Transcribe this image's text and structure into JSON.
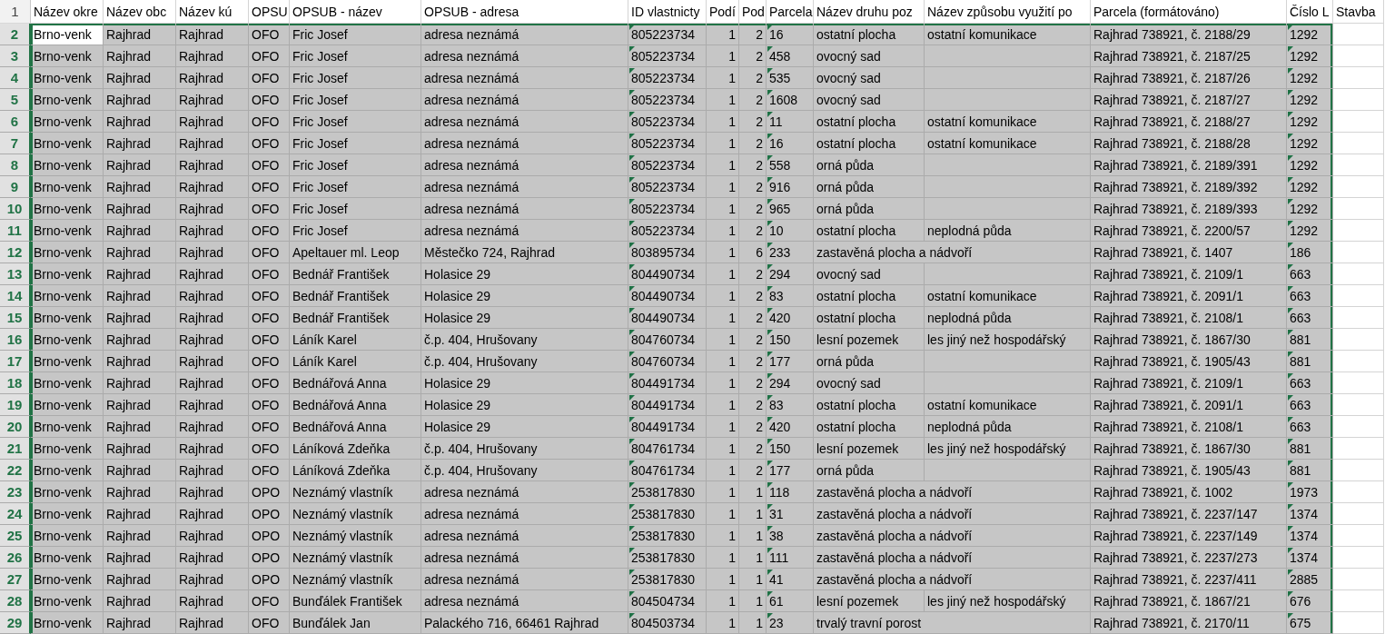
{
  "columns": [
    {
      "kind": "text",
      "selected": true,
      "flagged": false
    },
    {
      "kind": "text",
      "selected": true,
      "flagged": false
    },
    {
      "kind": "text",
      "selected": true,
      "flagged": false
    },
    {
      "kind": "text",
      "selected": true,
      "flagged": false
    },
    {
      "kind": "text",
      "selected": true,
      "flagged": false
    },
    {
      "kind": "text",
      "selected": true,
      "flagged": false
    },
    {
      "kind": "text",
      "selected": true,
      "flagged": true
    },
    {
      "kind": "number",
      "selected": true,
      "flagged": false
    },
    {
      "kind": "number",
      "selected": true,
      "flagged": false
    },
    {
      "kind": "text",
      "selected": true,
      "flagged": true
    },
    {
      "kind": "text",
      "selected": true,
      "flagged": false
    },
    {
      "kind": "text",
      "selected": true,
      "flagged": false
    },
    {
      "kind": "text",
      "selected": true,
      "flagged": false
    },
    {
      "kind": "text",
      "selected": true,
      "flagged": true
    },
    {
      "kind": "text",
      "selected": false,
      "flagged": false
    }
  ],
  "header_row": {
    "number": "1",
    "cells": [
      "Název okre",
      "Název obc",
      "Název kú",
      "OPSU",
      "OPSUB - název",
      "OPSUB  - adresa",
      "ID vlastnicty",
      "Podí",
      "Pod",
      "Parcela",
      "Název druhu poz",
      "Název způsobu využití po",
      "Parcela (formátováno)",
      "Číslo L",
      "Stavba"
    ]
  },
  "rows": [
    {
      "number": "2",
      "selected": true,
      "active": true,
      "cells": [
        "Brno-venk",
        "Rajhrad",
        "Rajhrad",
        "OFO",
        "Fric Josef",
        "adresa neznámá",
        "805223734",
        "1",
        "2",
        "16",
        "ostatní plocha",
        "ostatní komunikace",
        "Rajhrad 738921, č. 2188/29",
        "1292"
      ]
    },
    {
      "number": "3",
      "selected": true,
      "active": false,
      "cells": [
        "Brno-venk",
        "Rajhrad",
        "Rajhrad",
        "OFO",
        "Fric Josef",
        "adresa neznámá",
        "805223734",
        "1",
        "2",
        "458",
        "ovocný sad",
        null,
        "Rajhrad 738921, č. 2187/25",
        "1292"
      ]
    },
    {
      "number": "4",
      "selected": true,
      "active": false,
      "cells": [
        "Brno-venk",
        "Rajhrad",
        "Rajhrad",
        "OFO",
        "Fric Josef",
        "adresa neznámá",
        "805223734",
        "1",
        "2",
        "535",
        "ovocný sad",
        null,
        "Rajhrad 738921, č. 2187/26",
        "1292"
      ]
    },
    {
      "number": "5",
      "selected": true,
      "active": false,
      "cells": [
        "Brno-venk",
        "Rajhrad",
        "Rajhrad",
        "OFO",
        "Fric Josef",
        "adresa neznámá",
        "805223734",
        "1",
        "2",
        "1608",
        "ovocný sad",
        null,
        "Rajhrad 738921, č. 2187/27",
        "1292"
      ]
    },
    {
      "number": "6",
      "selected": true,
      "active": false,
      "cells": [
        "Brno-venk",
        "Rajhrad",
        "Rajhrad",
        "OFO",
        "Fric Josef",
        "adresa neznámá",
        "805223734",
        "1",
        "2",
        "11",
        "ostatní plocha",
        "ostatní komunikace",
        "Rajhrad 738921, č. 2188/27",
        "1292"
      ]
    },
    {
      "number": "7",
      "selected": true,
      "active": false,
      "cells": [
        "Brno-venk",
        "Rajhrad",
        "Rajhrad",
        "OFO",
        "Fric Josef",
        "adresa neznámá",
        "805223734",
        "1",
        "2",
        "16",
        "ostatní plocha",
        "ostatní komunikace",
        "Rajhrad 738921, č. 2188/28",
        "1292"
      ]
    },
    {
      "number": "8",
      "selected": true,
      "active": false,
      "cells": [
        "Brno-venk",
        "Rajhrad",
        "Rajhrad",
        "OFO",
        "Fric Josef",
        "adresa neznámá",
        "805223734",
        "1",
        "2",
        "558",
        "orná půda",
        null,
        "Rajhrad 738921, č. 2189/391",
        "1292"
      ]
    },
    {
      "number": "9",
      "selected": true,
      "active": false,
      "cells": [
        "Brno-venk",
        "Rajhrad",
        "Rajhrad",
        "OFO",
        "Fric Josef",
        "adresa neznámá",
        "805223734",
        "1",
        "2",
        "916",
        "orná půda",
        null,
        "Rajhrad 738921, č. 2189/392",
        "1292"
      ]
    },
    {
      "number": "10",
      "selected": true,
      "active": false,
      "cells": [
        "Brno-venk",
        "Rajhrad",
        "Rajhrad",
        "OFO",
        "Fric Josef",
        "adresa neznámá",
        "805223734",
        "1",
        "2",
        "965",
        "orná půda",
        null,
        "Rajhrad 738921, č. 2189/393",
        "1292"
      ]
    },
    {
      "number": "11",
      "selected": true,
      "active": false,
      "cells": [
        "Brno-venk",
        "Rajhrad",
        "Rajhrad",
        "OFO",
        "Fric Josef",
        "adresa neznámá",
        "805223734",
        "1",
        "2",
        "10",
        "ostatní plocha",
        "neplodná půda",
        "Rajhrad 738921, č. 2200/57",
        "1292"
      ]
    },
    {
      "number": "12",
      "selected": true,
      "active": false,
      "cells": [
        "Brno-venk",
        "Rajhrad",
        "Rajhrad",
        "OFO",
        "Apeltauer ml. Leop",
        "Městečko 724, Rajhrad",
        "803895734",
        "1",
        "6",
        "233",
        "zastavěná plocha a nádvoří",
        null,
        "Rajhrad 738921, č. 1407",
        "186"
      ]
    },
    {
      "number": "13",
      "selected": true,
      "active": false,
      "cells": [
        "Brno-venk",
        "Rajhrad",
        "Rajhrad",
        "OFO",
        "Bednář František",
        "Holasice 29",
        "804490734",
        "1",
        "2",
        "294",
        "ovocný sad",
        null,
        "Rajhrad 738921, č. 2109/1",
        "663"
      ]
    },
    {
      "number": "14",
      "selected": true,
      "active": false,
      "cells": [
        "Brno-venk",
        "Rajhrad",
        "Rajhrad",
        "OFO",
        "Bednář František",
        "Holasice 29",
        "804490734",
        "1",
        "2",
        "83",
        "ostatní plocha",
        "ostatní komunikace",
        "Rajhrad 738921, č. 2091/1",
        "663"
      ]
    },
    {
      "number": "15",
      "selected": true,
      "active": false,
      "cells": [
        "Brno-venk",
        "Rajhrad",
        "Rajhrad",
        "OFO",
        "Bednář František",
        "Holasice 29",
        "804490734",
        "1",
        "2",
        "420",
        "ostatní plocha",
        "neplodná půda",
        "Rajhrad 738921, č. 2108/1",
        "663"
      ]
    },
    {
      "number": "16",
      "selected": true,
      "active": false,
      "cells": [
        "Brno-venk",
        "Rajhrad",
        "Rajhrad",
        "OFO",
        "Láník Karel",
        "č.p. 404, Hrušovany",
        "804760734",
        "1",
        "2",
        "150",
        "lesní pozemek",
        "les jiný než hospodářský",
        "Rajhrad 738921, č. 1867/30",
        "881"
      ]
    },
    {
      "number": "17",
      "selected": true,
      "active": false,
      "cells": [
        "Brno-venk",
        "Rajhrad",
        "Rajhrad",
        "OFO",
        "Láník Karel",
        "č.p. 404, Hrušovany",
        "804760734",
        "1",
        "2",
        "177",
        "orná půda",
        null,
        "Rajhrad 738921, č. 1905/43",
        "881"
      ]
    },
    {
      "number": "18",
      "selected": true,
      "active": false,
      "cells": [
        "Brno-venk",
        "Rajhrad",
        "Rajhrad",
        "OFO",
        "Bednářová Anna",
        "Holasice 29",
        "804491734",
        "1",
        "2",
        "294",
        "ovocný sad",
        null,
        "Rajhrad 738921, č. 2109/1",
        "663"
      ]
    },
    {
      "number": "19",
      "selected": true,
      "active": false,
      "cells": [
        "Brno-venk",
        "Rajhrad",
        "Rajhrad",
        "OFO",
        "Bednářová Anna",
        "Holasice 29",
        "804491734",
        "1",
        "2",
        "83",
        "ostatní plocha",
        "ostatní komunikace",
        "Rajhrad 738921, č. 2091/1",
        "663"
      ]
    },
    {
      "number": "20",
      "selected": true,
      "active": false,
      "cells": [
        "Brno-venk",
        "Rajhrad",
        "Rajhrad",
        "OFO",
        "Bednářová Anna",
        "Holasice 29",
        "804491734",
        "1",
        "2",
        "420",
        "ostatní plocha",
        "neplodná půda",
        "Rajhrad 738921, č. 2108/1",
        "663"
      ]
    },
    {
      "number": "21",
      "selected": true,
      "active": false,
      "cells": [
        "Brno-venk",
        "Rajhrad",
        "Rajhrad",
        "OFO",
        "Láníková Zdeňka",
        "č.p. 404, Hrušovany",
        "804761734",
        "1",
        "2",
        "150",
        "lesní pozemek",
        "les jiný než hospodářský",
        "Rajhrad 738921, č. 1867/30",
        "881"
      ]
    },
    {
      "number": "22",
      "selected": true,
      "active": false,
      "cells": [
        "Brno-venk",
        "Rajhrad",
        "Rajhrad",
        "OFO",
        "Láníková Zdeňka",
        "č.p. 404, Hrušovany",
        "804761734",
        "1",
        "2",
        "177",
        "orná půda",
        null,
        "Rajhrad 738921, č. 1905/43",
        "881"
      ]
    },
    {
      "number": "23",
      "selected": true,
      "active": false,
      "cells": [
        "Brno-venk",
        "Rajhrad",
        "Rajhrad",
        "OPO",
        "Neznámý vlastník",
        "adresa neznámá",
        "253817830",
        "1",
        "1",
        "118",
        "zastavěná plocha a nádvoří",
        null,
        "Rajhrad 738921, č. 1002",
        "1973"
      ]
    },
    {
      "number": "24",
      "selected": true,
      "active": false,
      "cells": [
        "Brno-venk",
        "Rajhrad",
        "Rajhrad",
        "OPO",
        "Neznámý vlastník",
        "adresa neznámá",
        "253817830",
        "1",
        "1",
        "31",
        "zastavěná plocha a nádvoří",
        null,
        "Rajhrad 738921, č. 2237/147",
        "1374"
      ]
    },
    {
      "number": "25",
      "selected": true,
      "active": false,
      "cells": [
        "Brno-venk",
        "Rajhrad",
        "Rajhrad",
        "OPO",
        "Neznámý vlastník",
        "adresa neznámá",
        "253817830",
        "1",
        "1",
        "38",
        "zastavěná plocha a nádvoří",
        null,
        "Rajhrad 738921, č. 2237/149",
        "1374"
      ]
    },
    {
      "number": "26",
      "selected": true,
      "active": false,
      "cells": [
        "Brno-venk",
        "Rajhrad",
        "Rajhrad",
        "OPO",
        "Neznámý vlastník",
        "adresa neznámá",
        "253817830",
        "1",
        "1",
        "111",
        "zastavěná plocha a nádvoří",
        null,
        "Rajhrad 738921, č. 2237/273",
        "1374"
      ]
    },
    {
      "number": "27",
      "selected": true,
      "active": false,
      "cells": [
        "Brno-venk",
        "Rajhrad",
        "Rajhrad",
        "OPO",
        "Neznámý vlastník",
        "adresa neznámá",
        "253817830",
        "1",
        "1",
        "41",
        "zastavěná plocha a nádvoří",
        null,
        "Rajhrad 738921, č. 2237/411",
        "2885"
      ]
    },
    {
      "number": "28",
      "selected": true,
      "active": false,
      "cells": [
        "Brno-venk",
        "Rajhrad",
        "Rajhrad",
        "OFO",
        "Bunďálek František",
        "adresa neznámá",
        "804504734",
        "1",
        "1",
        "61",
        "lesní pozemek",
        "les jiný než hospodářský",
        "Rajhrad 738921, č. 1867/21",
        "676"
      ]
    },
    {
      "number": "29",
      "selected": true,
      "active": false,
      "cells": [
        "Brno-venk",
        "Rajhrad",
        "Rajhrad",
        "OFO",
        "Bunďálek Jan",
        "Palackého 716, 66461 Rajhrad",
        "804503734",
        "1",
        "1",
        "23",
        "trvalý travní porost",
        null,
        "Rajhrad 738921, č. 2170/11",
        "675"
      ]
    }
  ]
}
